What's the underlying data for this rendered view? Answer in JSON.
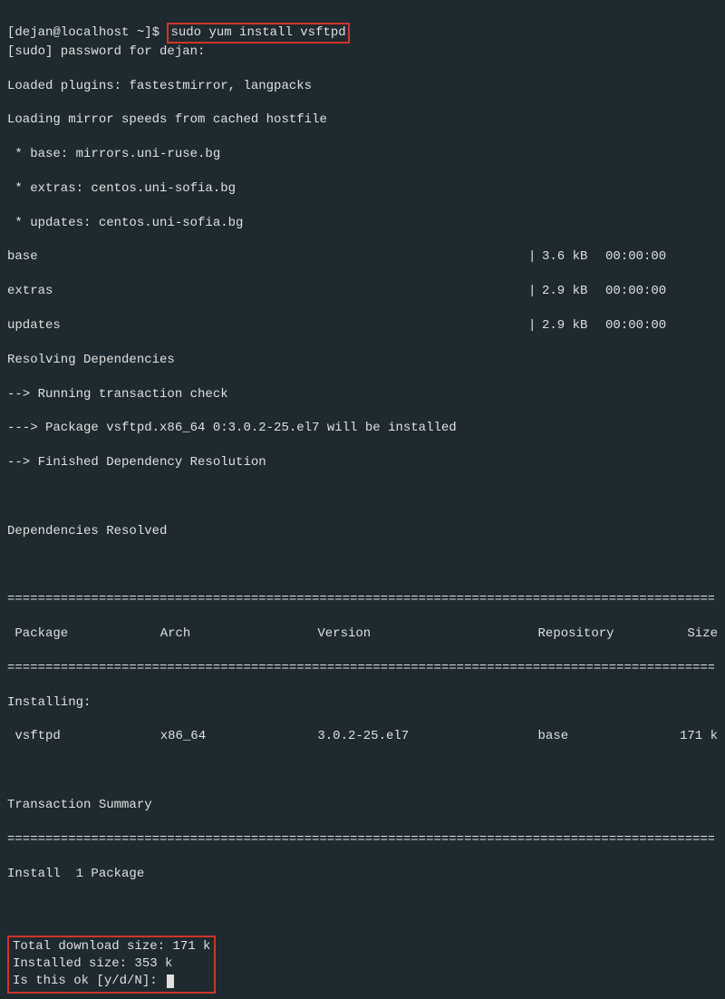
{
  "prompt": {
    "user_host": "[dejan@localhost ~]$ ",
    "command": "sudo yum install vsftpd"
  },
  "output": {
    "sudo_pw": "[sudo] password for dejan:",
    "line1": "Loaded plugins: fastestmirror, langpacks",
    "line2": "Loading mirror speeds from cached hostfile",
    "mirror1": " * base: mirrors.uni-ruse.bg",
    "mirror2": " * extras: centos.uni-sofia.bg",
    "mirror3": " * updates: centos.uni-sofia.bg",
    "repos": [
      {
        "name": "base",
        "size": "3.6 kB",
        "time": "00:00:00"
      },
      {
        "name": "extras",
        "size": "2.9 kB",
        "time": "00:00:00"
      },
      {
        "name": "updates",
        "size": "2.9 kB",
        "time": "00:00:00"
      }
    ],
    "resolving": "Resolving Dependencies",
    "check": "--> Running transaction check",
    "pkg_install": "---> Package vsftpd.x86_64 0:3.0.2-25.el7 will be installed",
    "finished": "--> Finished Dependency Resolution",
    "deps_resolved": "Dependencies Resolved",
    "divider": "================================================================================================",
    "headers": {
      "package": " Package",
      "arch": "Arch",
      "version": "Version",
      "repository": "Repository",
      "size": "Size"
    },
    "install_header": "Installing:",
    "pkg_row": {
      "name": " vsftpd",
      "arch": "x86_64",
      "version": "3.0.2-25.el7",
      "repo": "base",
      "size": "171 k"
    },
    "trans_summary": "Transaction Summary",
    "install_count": "Install  1 Package",
    "box": {
      "dl_size": "Total download size: 171 k",
      "inst_size": "Installed size: 353 k",
      "prompt": "Is this ok [y/d/N]: "
    }
  }
}
